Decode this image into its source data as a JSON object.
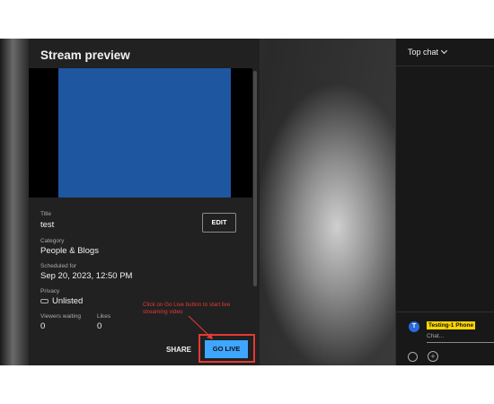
{
  "stream_preview": {
    "title": "Stream preview",
    "edit_label": "EDIT",
    "fields": {
      "title_label": "Title",
      "title_value": "test",
      "category_label": "Category",
      "category_value": "People & Blogs",
      "scheduled_label": "Scheduled for",
      "scheduled_value": "Sep 20, 2023, 12:50 PM",
      "privacy_label": "Privacy",
      "privacy_value": "Unlisted",
      "viewers_label": "Viewers waiting",
      "viewers_value": "0",
      "likes_label": "Likes",
      "likes_value": "0"
    },
    "share_label": "SHARE",
    "go_live_label": "GO LIVE",
    "annotation": "Click on Go Live button to start live streaming video",
    "preview_color": "#1e56a0"
  },
  "chat": {
    "header": "Top chat",
    "avatar_initial": "T",
    "username": "Testing-1 Phone",
    "input_placeholder": "Chat...",
    "highlight_color": "#ffd600"
  },
  "colors": {
    "accent": "#3ea6ff",
    "annotation": "#e53935"
  }
}
